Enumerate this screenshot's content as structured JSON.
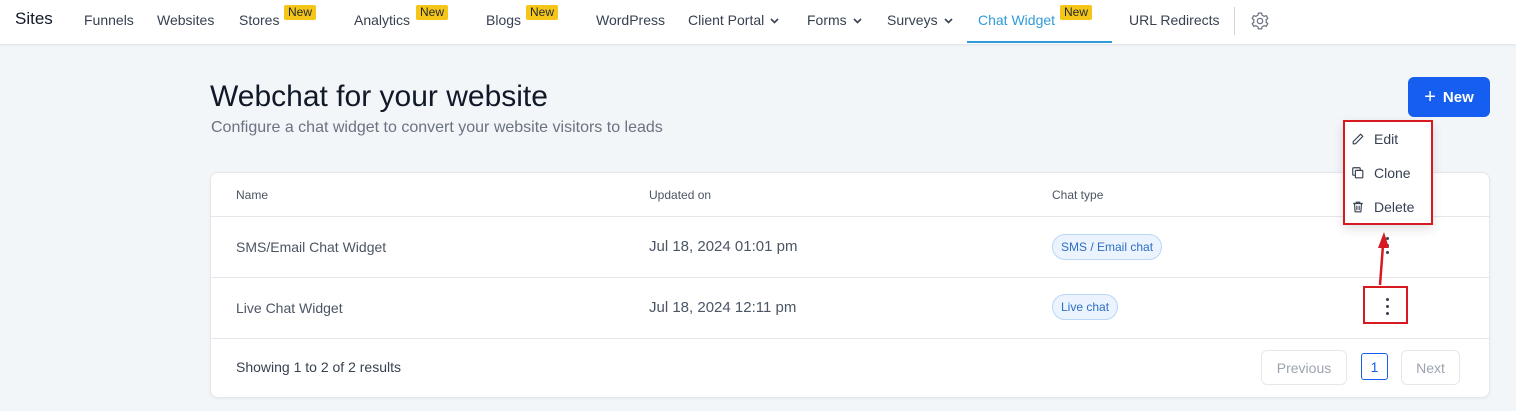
{
  "nav": {
    "brand": "Sites",
    "items": [
      {
        "label": "Funnels"
      },
      {
        "label": "Websites"
      },
      {
        "label": "Stores",
        "badge": "New"
      },
      {
        "label": "Analytics",
        "badge": "New"
      },
      {
        "label": "Blogs",
        "badge": "New"
      },
      {
        "label": "WordPress"
      },
      {
        "label": "Client Portal"
      },
      {
        "label": "Forms"
      },
      {
        "label": "Surveys"
      },
      {
        "label": "Chat Widget",
        "badge": "New",
        "active": true
      },
      {
        "label": "URL Redirects"
      }
    ],
    "settings_icon": "gear-icon"
  },
  "header": {
    "title": "Webchat for your website",
    "subtitle": "Configure a chat widget to convert your website visitors to leads",
    "new_button": "New"
  },
  "table": {
    "columns": [
      "Name",
      "Updated on",
      "Chat type"
    ],
    "rows": [
      {
        "name": "SMS/Email Chat Widget",
        "updated": "Jul 18, 2024 01:01 pm",
        "chat_type": "SMS / Email chat"
      },
      {
        "name": "Live Chat Widget",
        "updated": "Jul 18, 2024 12:11 pm",
        "chat_type": "Live chat"
      }
    ]
  },
  "pagination": {
    "summary": "Showing 1 to 2 of 2 results",
    "previous": "Previous",
    "current_page": "1",
    "next": "Next"
  },
  "menu": {
    "items": [
      {
        "label": "Edit",
        "icon": "pencil-icon"
      },
      {
        "label": "Clone",
        "icon": "copy-icon"
      },
      {
        "label": "Delete",
        "icon": "trash-icon"
      }
    ]
  },
  "colors": {
    "accent": "#155eef",
    "active_tab": "#2f9bd6",
    "badge": "#f5c518",
    "annotation": "#d71920"
  }
}
